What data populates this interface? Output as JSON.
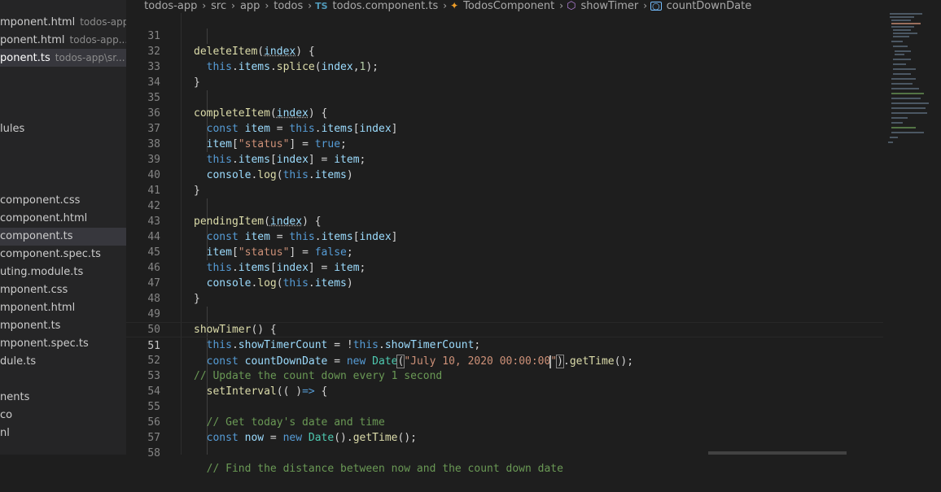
{
  "open_editors": [
    {
      "name": "mponent.html",
      "desc": "todos-app\\s...",
      "active": false
    },
    {
      "name": "ponent.html",
      "desc": "todos-app...",
      "active": false
    },
    {
      "name": "ponent.ts",
      "desc": "todos-app\\sr...",
      "active": true
    }
  ],
  "tree": [
    {
      "label": "lules",
      "top": 0
    },
    {
      "label": "component.css"
    },
    {
      "label": "component.html"
    },
    {
      "label": "component.ts",
      "active": true
    },
    {
      "label": "component.spec.ts"
    },
    {
      "label": "uting.module.ts"
    },
    {
      "label": "mponent.css"
    },
    {
      "label": "mponent.html"
    },
    {
      "label": "mponent.ts"
    },
    {
      "label": "mponent.spec.ts"
    },
    {
      "label": "dule.ts"
    },
    {
      "label": "nents"
    },
    {
      "label": "co"
    },
    {
      "label": "nl"
    }
  ],
  "breadcrumb": {
    "seg1": "todos-app",
    "seg2": "src",
    "seg3": "app",
    "seg4": "todos",
    "file_badge": "TS",
    "file": "todos.component.ts",
    "class": "TodosComponent",
    "method": "showTimer",
    "variable": "countDownDate"
  },
  "line_numbers": [
    "31",
    "32",
    "33",
    "34",
    "35",
    "36",
    "37",
    "38",
    "39",
    "40",
    "41",
    "42",
    "43",
    "44",
    "45",
    "46",
    "47",
    "48",
    "49",
    "50",
    "51",
    "52",
    "53",
    "54",
    "55",
    "56",
    "57",
    "58"
  ],
  "code": {
    "l31": {
      "a": "deleteItem",
      "b": "(",
      "c": "index",
      "d": ") {"
    },
    "l32": {
      "a": "this",
      "b": ".",
      "c": "items",
      "d": ".",
      "e": "splice",
      "f": "(",
      "g": "index",
      "h": ",",
      "i": "1",
      "j": ");"
    },
    "l33": "}",
    "l35": {
      "a": "completeItem",
      "b": "(",
      "c": "index",
      "d": ") {"
    },
    "l36": {
      "a": "const",
      "b": "item",
      "c": " = ",
      "d": "this",
      "e": ".",
      "f": "items",
      "g": "[",
      "h": "index",
      "i": "]"
    },
    "l37": {
      "a": "item",
      "b": "[",
      "c": "\"status\"",
      "d": "] = ",
      "e": "true",
      "f": ";"
    },
    "l38": {
      "a": "this",
      "b": ".",
      "c": "items",
      "d": "[",
      "e": "index",
      "f": "] = ",
      "g": "item",
      "h": ";"
    },
    "l39": {
      "a": "console",
      "b": ".",
      "c": "log",
      "d": "(",
      "e": "this",
      "f": ".",
      "g": "items",
      "h": ")"
    },
    "l40": "}",
    "l42": {
      "a": "pendingItem",
      "b": "(",
      "c": "index",
      "d": ") {"
    },
    "l43": {
      "a": "const",
      "b": "item",
      "c": " = ",
      "d": "this",
      "e": ".",
      "f": "items",
      "g": "[",
      "h": "index",
      "i": "]"
    },
    "l44": {
      "a": "item",
      "b": "[",
      "c": "\"status\"",
      "d": "] = ",
      "e": "false",
      "f": ";"
    },
    "l45": {
      "a": "this",
      "b": ".",
      "c": "items",
      "d": "[",
      "e": "index",
      "f": "] = ",
      "g": "item",
      "h": ";"
    },
    "l46": {
      "a": "console",
      "b": ".",
      "c": "log",
      "d": "(",
      "e": "this",
      "f": ".",
      "g": "items",
      "h": ")"
    },
    "l47": "}",
    "l49": {
      "a": "showTimer",
      "b": "() {"
    },
    "l50": {
      "a": "this",
      "b": ".",
      "c": "showTimerCount",
      "d": " = !",
      "e": "this",
      "f": ".",
      "g": "showTimerCount",
      "h": ";"
    },
    "l51": {
      "a": "const",
      "b": "countDownDate",
      "c": " = ",
      "d": "new",
      "e": "Date",
      "f": "(",
      "g": "\"July 10, 2020 00:00:00",
      "h": "\"",
      "i": ")",
      "j": ".",
      "k": "getTime",
      "l": "();"
    },
    "l52": "// Update the count down every 1 second",
    "l53": {
      "a": "setInterval",
      "b": "(( )",
      "c": "=>",
      "d": " {"
    },
    "l55": "// Get today's date and time",
    "l56": {
      "a": "const",
      "b": "now",
      "c": " = ",
      "d": "new",
      "e": "Date",
      "f": "().",
      "g": "getTime",
      "h": "();"
    },
    "l58": "// Find the distance between now and the count down date"
  }
}
